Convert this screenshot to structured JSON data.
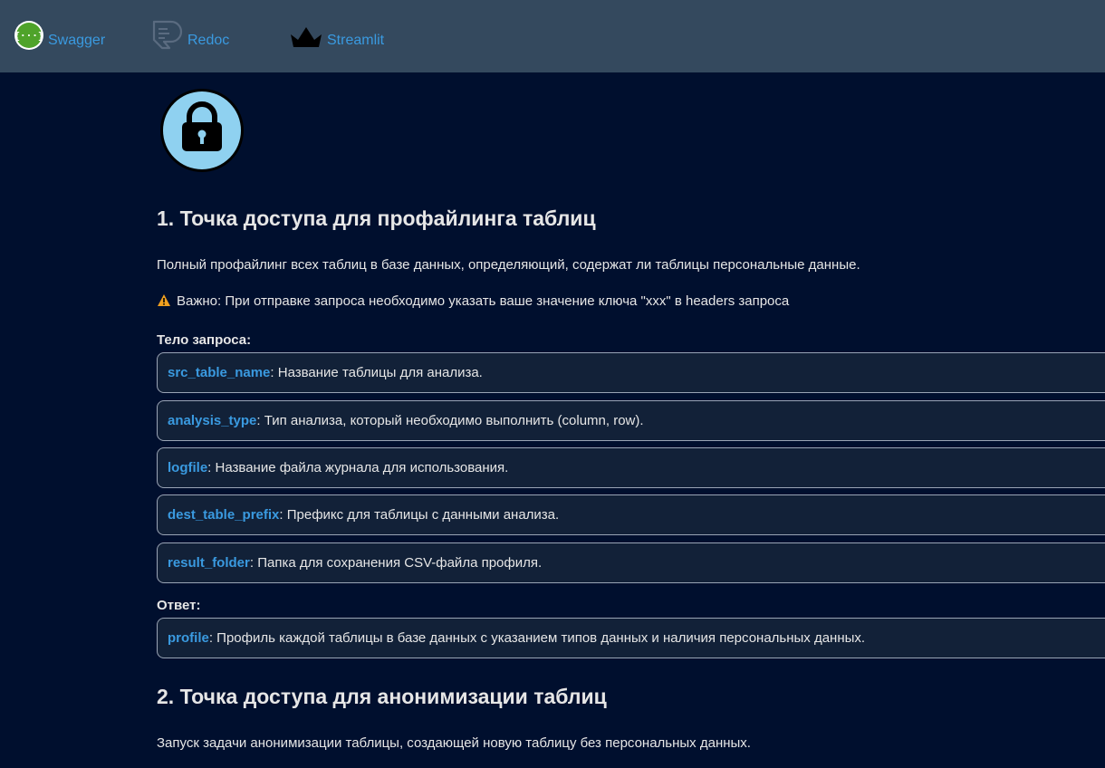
{
  "nav": {
    "swagger_label": "Swagger",
    "redoc_label": "Redoc",
    "streamlit_label": "Streamlit"
  },
  "icons": {
    "swagger": "swagger-logo-icon",
    "redoc": "redoc-logo-icon",
    "streamlit": "streamlit-crown-icon",
    "lock": "lock-icon",
    "warning": "warning-icon"
  },
  "colors": {
    "page_bg": "#000f2e",
    "topbar_bg": "#34495e",
    "link": "#3a9ae0",
    "box_bg": "#122138",
    "box_border": "#9aa4b5",
    "lock_circle": "#8fd1f0",
    "swagger_green": "#4fa32a",
    "warning": "#f0a020"
  },
  "section1": {
    "title": "1. Точка доступа для профайлинга таблиц",
    "description": "Полный профайлинг всех таблиц в базе данных, определяющий, содержат ли таблицы персональные данные.",
    "warning": "Важно: При отправке запроса необходимо указать ваше значение ключа \"xxx\" в headers запроса",
    "request_label": "Тело запроса:",
    "request_fields": [
      {
        "name": "src_table_name",
        "desc": ": Название таблицы для анализа."
      },
      {
        "name": "analysis_type",
        "desc": ": Тип анализа, который необходимо выполнить (column, row)."
      },
      {
        "name": "logfile",
        "desc": ": Название файла журнала для использования."
      },
      {
        "name": "dest_table_prefix",
        "desc": ": Префикс для таблицы с данными анализа."
      },
      {
        "name": "result_folder",
        "desc": ": Папка для сохранения CSV-файла профиля."
      }
    ],
    "response_label": "Ответ:",
    "response_fields": [
      {
        "name": "profile",
        "desc": ": Профиль каждой таблицы в базе данных с указанием типов данных и наличия персональных данных."
      }
    ]
  },
  "section2": {
    "title": "2. Точка доступа для анонимизации таблиц",
    "description": "Запуск задачи анонимизации таблицы, создающей новую таблицу без персональных данных."
  }
}
